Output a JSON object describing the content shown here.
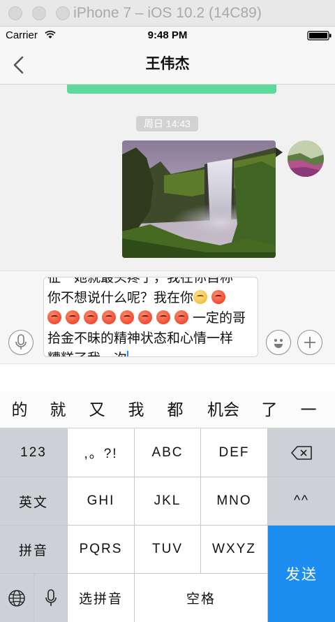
{
  "simulator": {
    "title": "iPhone 7 – iOS 10.2 (14C89)"
  },
  "status_bar": {
    "carrier": "Carrier",
    "time": "9:48 PM"
  },
  "nav": {
    "back_icon": "chevron-left-icon",
    "title": "王伟杰"
  },
  "chat": {
    "timestamp": "周日 14:43",
    "image_message": {
      "icon": "waterfall-photo"
    },
    "avatar_icon": "avatar-photo"
  },
  "input": {
    "text_line1": "征一她就最头疼了，我在你自称",
    "text_line2": "你不想说什么呢？我在你",
    "text_line3_tail": "一定的哥",
    "text_line4": "拾金不昧的精神状态和心情一样",
    "text_line5": "糟糕了我一次",
    "voice_icon": "microphone-icon",
    "emoji_icon": "smiley-icon",
    "plus_icon": "plus-icon"
  },
  "candidates": [
    "的",
    "就",
    "又",
    "我",
    "都",
    "机会",
    "了",
    "一"
  ],
  "keyboard": {
    "row1": {
      "num": "123",
      "punct": ",。?!",
      "abc": "ABC",
      "def": "DEF",
      "delete_icon": "backspace-icon"
    },
    "row2": {
      "english": "英文",
      "ghi": "GHI",
      "jkl": "JKL",
      "mno": "MNO",
      "emoticon": "^^"
    },
    "row3": {
      "pinyin": "拼音",
      "pqrs": "PQRS",
      "tuv": "TUV",
      "wxyz": "WXYZ"
    },
    "row4": {
      "globe_icon": "globe-icon",
      "mic_icon": "microphone-icon",
      "select_pinyin": "选拼音",
      "space": "空格"
    },
    "send": "发送"
  },
  "colors": {
    "accent_green": "#5fd99b",
    "send_blue": "#1d8df2"
  }
}
